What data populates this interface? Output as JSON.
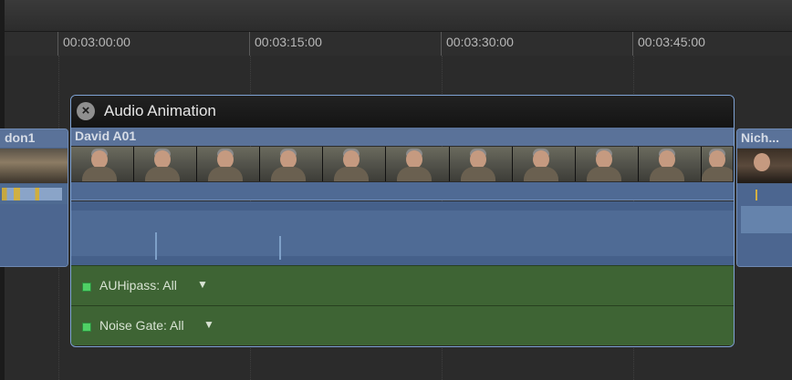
{
  "ruler": {
    "timecodes": [
      "00:03:00:00",
      "00:03:15:00",
      "00:03:30:00",
      "00:03:45:00"
    ]
  },
  "clips": {
    "left_name": "don1",
    "main_name": "David A01",
    "right_name": "Nich..."
  },
  "panel": {
    "title": "Audio Animation",
    "close_symbol": "×"
  },
  "effects": [
    {
      "label": "AUHipass: All",
      "arrow": "▼"
    },
    {
      "label": "Noise Gate: All",
      "arrow": "▼"
    }
  ],
  "colors": {
    "clip_blue": "#4a6388",
    "effect_green": "#3e6434",
    "selection_outline": "#7fa3d4"
  }
}
